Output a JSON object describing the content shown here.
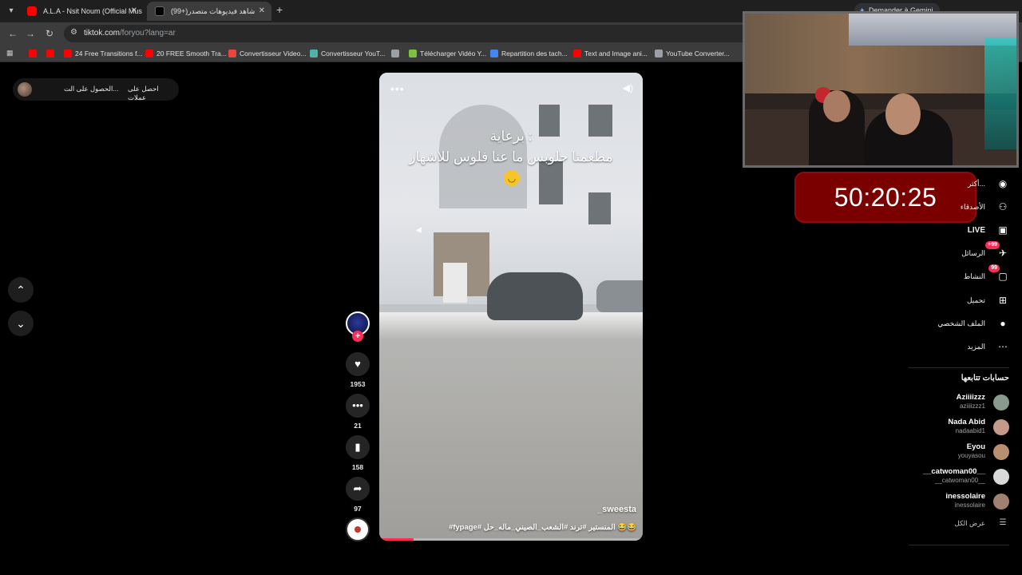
{
  "browser": {
    "tabs": [
      {
        "title": "A.L.A - Nsit Noum (Official Mus",
        "favicon_color": "#ff0000"
      },
      {
        "title": "(99+)شاهد فيديوهات متصدر",
        "favicon_color": "#000000"
      }
    ],
    "gemini_label": "Demander à Gemini",
    "url_host": "tiktok.com",
    "url_path": "/foryou?lang=ar",
    "bookmarks": [
      {
        "label": "",
        "color": "#ff0000"
      },
      {
        "label": "",
        "color": "#ff0000"
      },
      {
        "label": "24 Free Transitions f...",
        "color": "#ff0000"
      },
      {
        "label": "20 FREE Smooth Tra...",
        "color": "#ff0000"
      },
      {
        "label": "Convertisseur Video...",
        "color": "#e8453c"
      },
      {
        "label": "Convertisseur YouT...",
        "color": "#4fb2a8"
      },
      {
        "label": "",
        "color": "#9aa0a6"
      },
      {
        "label": "Télécharger Vidéo Y...",
        "color": "#7cc142"
      },
      {
        "label": "Repartition des tach...",
        "color": "#4285f4"
      },
      {
        "label": "Text and Image ani...",
        "color": "#ff0000"
      },
      {
        "label": "YouTube Converter...",
        "color": "#9aa0a6"
      }
    ]
  },
  "page": {
    "get_coins": "احصل على عملات",
    "get_app": "الحصول على الت...",
    "video": {
      "caption_line1": "برعاية :",
      "caption_line2": "مطعمنا حلوبس ما عنا فلوس للاشهار",
      "emoji": "🙃",
      "author": "_sweesta",
      "description": "#fypage# المنستير #ترند #الشعب_الصيني_ماله_حل 😂😂",
      "progress": 0.13
    },
    "actions": {
      "likes": "1953",
      "comments": "21",
      "saves": "158",
      "shares": "97"
    },
    "right_nav": [
      {
        "label": "أكثر...",
        "icon": "foryou-icon"
      },
      {
        "label": "الأصدقاء",
        "icon": "friends-icon"
      },
      {
        "label": "LIVE",
        "icon": "live-icon"
      },
      {
        "label": "الرسائل",
        "icon": "messages-icon",
        "badge": "+99"
      },
      {
        "label": "النشاط",
        "icon": "activity-icon",
        "badge": "99"
      },
      {
        "label": "تحميل",
        "icon": "upload-icon"
      },
      {
        "label": "الملف الشخصي",
        "icon": "profile-icon"
      },
      {
        "label": "المزيد",
        "icon": "more-icon"
      }
    ],
    "following_title": "حسابات تتابعها",
    "following": [
      {
        "name": "Aziiiizzz",
        "username": "aziiiizzz1",
        "color": "#8a9a8c"
      },
      {
        "name": "Nada Abid",
        "username": "nadaabid1",
        "color": "#c49a8a"
      },
      {
        "name": "Eyou",
        "username": "youyasou",
        "color": "#b89070"
      },
      {
        "name": "__catwoman00__",
        "username": "__catwoman00__",
        "color": "#d8d8d8"
      },
      {
        "name": "inessolaire",
        "username": "inessolaire",
        "color": "#a08070"
      }
    ],
    "see_all": "عرض الكل"
  },
  "overlay": {
    "timer": "50:20:25"
  }
}
